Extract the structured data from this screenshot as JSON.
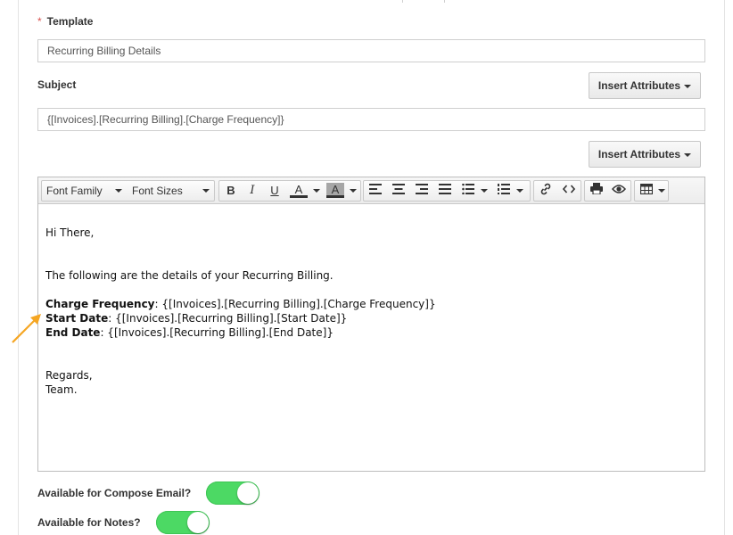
{
  "template": {
    "label": "Template",
    "required_marker": "*",
    "value": "Recurring Billing Details"
  },
  "subject": {
    "label": "Subject",
    "value": "{[Invoices].[Recurring Billing].[Charge Frequency]}"
  },
  "insert_attributes_label": "Insert Attributes",
  "toolbar": {
    "font_family": "Font Family",
    "font_sizes": "Font Sizes",
    "bold": "B",
    "italic": "I",
    "underline": "U",
    "text_color": "A",
    "bg_color": "A"
  },
  "body": {
    "greeting": "Hi There,",
    "intro": "The following are the details of your Recurring Billing.",
    "fields": [
      {
        "label": "Charge Frequency",
        "value": ": {[Invoices].[Recurring Billing].[Charge Frequency]}"
      },
      {
        "label": "Start Date",
        "value": ": {[Invoices].[Recurring Billing].[Start Date]}"
      },
      {
        "label": "End Date",
        "value": ": {[Invoices].[Recurring Billing].[End Date]}"
      }
    ],
    "closing": "Regards,",
    "signature": "Team."
  },
  "toggles": [
    {
      "label": "Available for Compose Email?",
      "on": true
    },
    {
      "label": "Available for Notes?",
      "on": true
    }
  ],
  "colors": {
    "toggle_on": "#4cd964",
    "required": "#d9534f",
    "arrow": "#f5a623"
  }
}
